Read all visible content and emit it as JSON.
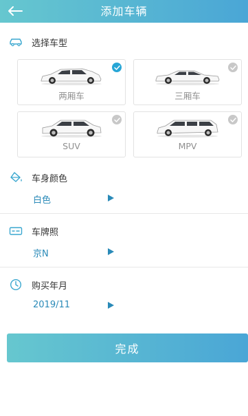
{
  "header": {
    "title": "添加车辆",
    "back_icon": "arrow-left-icon"
  },
  "car_type_section": {
    "title": "选择车型",
    "icon": "car-icon",
    "options": [
      {
        "label": "两厢车",
        "selected": true
      },
      {
        "label": "三厢车",
        "selected": false
      },
      {
        "label": "SUV",
        "selected": false
      },
      {
        "label": "MPV",
        "selected": false
      }
    ]
  },
  "color_section": {
    "title": "车身颜色",
    "icon": "paint-bucket-icon",
    "value": "白色"
  },
  "plate_section": {
    "title": "车牌照",
    "icon": "license-plate-icon",
    "value": "京N"
  },
  "purchase_section": {
    "title": "购买年月",
    "icon": "clock-icon",
    "value": "2019/11"
  },
  "done_button": {
    "label": "完成"
  },
  "colors": {
    "accent": "#4aa6d6",
    "accent_start": "#66c7cf",
    "value_text": "#2a8ab8",
    "check_selected": "#27a6d6",
    "check_unselected": "#c8c8c8"
  }
}
